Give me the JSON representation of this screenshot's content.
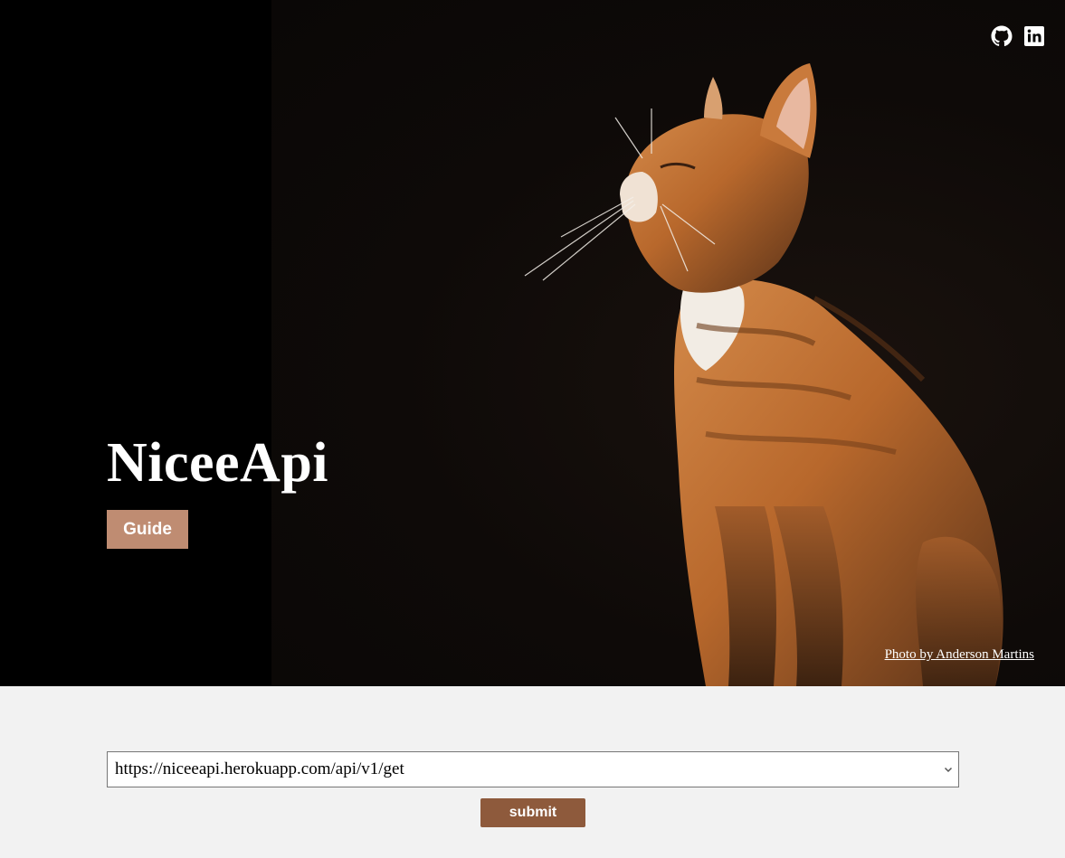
{
  "hero": {
    "brand_title": "NiceeApi",
    "guide_label": "Guide",
    "photo_credit": "Photo by Anderson Martins"
  },
  "social": {
    "github_icon": "github-icon",
    "linkedin_icon": "linkedin-icon"
  },
  "form": {
    "endpoint_selected": "https://niceeapi.herokuapp.com/api/v1/get",
    "submit_label": "submit"
  },
  "colors": {
    "guide_button": "#bf8c72",
    "submit_button": "#8e5a3c",
    "page_background": "#f2f2f2",
    "hero_background": "#000000"
  }
}
